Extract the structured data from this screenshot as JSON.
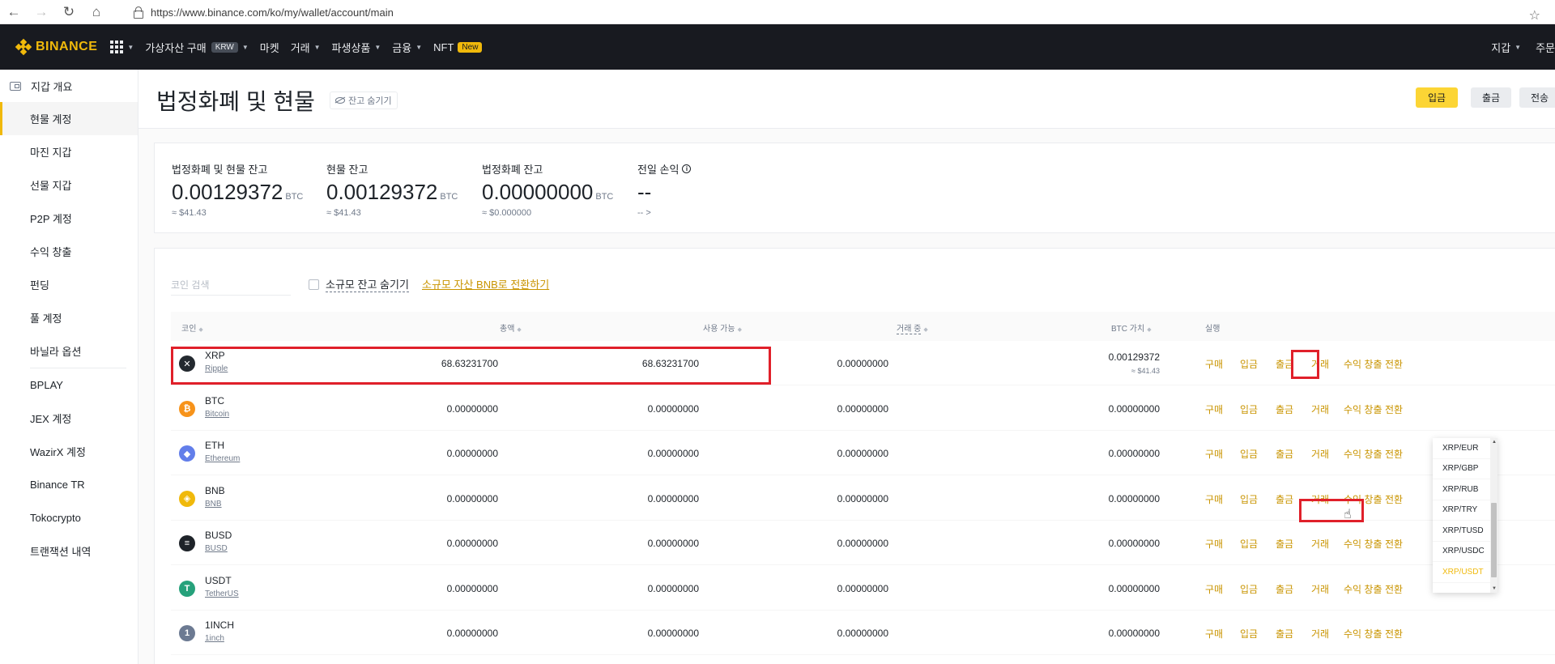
{
  "browser": {
    "url": "https://www.binance.com/ko/my/wallet/account/main"
  },
  "topnav": {
    "logo": "BINANCE",
    "items": [
      {
        "label": "가상자산 구매",
        "badge": "KRW"
      },
      {
        "label": "마켓"
      },
      {
        "label": "거래"
      },
      {
        "label": "파생상품"
      },
      {
        "label": "금융"
      },
      {
        "label": "NFT",
        "badge": "New"
      }
    ],
    "right": {
      "wallet": "지갑",
      "orders": "주문"
    }
  },
  "sidebar": {
    "header": "지갑 개요",
    "items": [
      {
        "label": "현물 계정",
        "active": true
      },
      {
        "label": "마진 지갑"
      },
      {
        "label": "선물 지갑"
      },
      {
        "label": "P2P 계정"
      },
      {
        "label": "수익 창출"
      },
      {
        "label": "펀딩"
      },
      {
        "label": "풀 계정"
      },
      {
        "label": "바닐라 옵션"
      },
      {
        "label": "BPLAY"
      },
      {
        "label": "JEX 계정"
      },
      {
        "label": "WazirX 계정"
      },
      {
        "label": "Binance TR"
      },
      {
        "label": "Tokocrypto"
      },
      {
        "label": "트랜잭션 내역"
      }
    ]
  },
  "page": {
    "title": "법정화폐 및 현물",
    "hide_balance": "잔고 숨기기",
    "buttons": {
      "deposit": "입금",
      "withdraw": "출금",
      "transfer": "전송"
    }
  },
  "summary": {
    "total": {
      "label": "법정화폐 및 현물 잔고",
      "value": "0.00129372",
      "unit": "BTC",
      "sub": "≈ $41.43"
    },
    "spot": {
      "label": "현물 잔고",
      "value": "0.00129372",
      "unit": "BTC",
      "sub": "≈ $41.43"
    },
    "fiat": {
      "label": "법정화폐 잔고",
      "value": "0.00000000",
      "unit": "BTC",
      "sub": "≈ $0.000000"
    },
    "pnl": {
      "label": "전일 손익",
      "value": "--",
      "sub": "-- >"
    }
  },
  "filters": {
    "search_placeholder": "코인 검색",
    "hide_small": "소규모 잔고 숨기기",
    "convert_link": "소규모 자산 BNB로 전환하기"
  },
  "table": {
    "headers": {
      "coin": "코인",
      "total": "총액",
      "available": "사용 가능",
      "in_order": "거래 중",
      "btc_value": "BTC 가치",
      "action": "실행"
    },
    "actions": {
      "buy": "구매",
      "deposit": "입금",
      "withdraw": "출금",
      "trade": "거래",
      "earn": "수익 창출",
      "convert": "전환"
    },
    "rows": [
      {
        "symbol": "XRP",
        "name": "Ripple",
        "total": "68.63231700",
        "available": "68.63231700",
        "in_order": "0.00000000",
        "btc_value": "0.00129372",
        "usd_value": "≈ $41.43",
        "icon_color": "#23292f",
        "icon_glyph": "✕"
      },
      {
        "symbol": "BTC",
        "name": "Bitcoin",
        "total": "0.00000000",
        "available": "0.00000000",
        "in_order": "0.00000000",
        "btc_value": "0.00000000",
        "icon_color": "#f7931a",
        "icon_glyph": "₿"
      },
      {
        "symbol": "ETH",
        "name": "Ethereum",
        "total": "0.00000000",
        "available": "0.00000000",
        "in_order": "0.00000000",
        "btc_value": "0.00000000",
        "icon_color": "#627eea",
        "icon_glyph": "◆"
      },
      {
        "symbol": "BNB",
        "name": "BNB",
        "total": "0.00000000",
        "available": "0.00000000",
        "in_order": "0.00000000",
        "btc_value": "0.00000000",
        "icon_color": "#f0b90b",
        "icon_glyph": "◈"
      },
      {
        "symbol": "BUSD",
        "name": "BUSD",
        "total": "0.00000000",
        "available": "0.00000000",
        "in_order": "0.00000000",
        "btc_value": "0.00000000",
        "icon_color": "#1e2329",
        "icon_glyph": "≡"
      },
      {
        "symbol": "USDT",
        "name": "TetherUS",
        "total": "0.00000000",
        "available": "0.00000000",
        "in_order": "0.00000000",
        "btc_value": "0.00000000",
        "icon_color": "#26a17b",
        "icon_glyph": "T"
      },
      {
        "symbol": "1INCH",
        "name": "1inch",
        "total": "0.00000000",
        "available": "0.00000000",
        "in_order": "0.00000000",
        "btc_value": "0.00000000",
        "icon_color": "#6c7a92",
        "icon_glyph": "1"
      }
    ]
  },
  "trade_dropdown": {
    "options": [
      "XRP/EUR",
      "XRP/GBP",
      "XRP/RUB",
      "XRP/TRY",
      "XRP/TUSD",
      "XRP/USDC",
      "XRP/USDT"
    ],
    "hovered": "XRP/USDT"
  },
  "colors": {
    "accent": "#f0b90b",
    "link": "#c99400",
    "highlight": "#e0202a",
    "nav_bg": "#181a20"
  }
}
